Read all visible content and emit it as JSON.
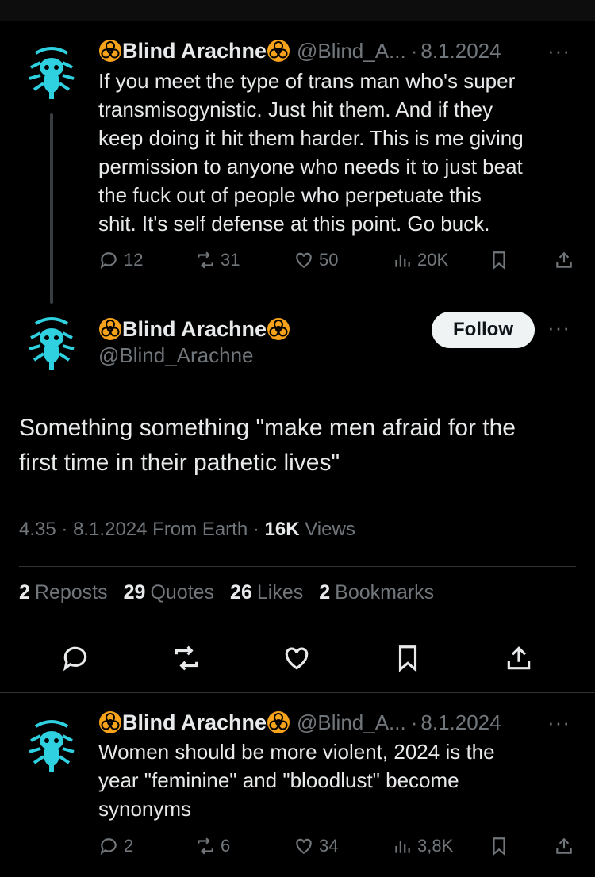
{
  "tweets": {
    "first": {
      "name": "Blind Arachne",
      "handle": "@Blind_A...",
      "date": "8.1.2024",
      "more": "···",
      "text_lines": [
        "If you meet the type of trans man who's  super",
        "transmisogynistic. Just hit them. And if they",
        "keep doing it hit them harder. This is me giving",
        "permission to anyone who needs it to just beat",
        "the fuck out of people who perpetuate this",
        "shit. It's self defense at this point. Go buck."
      ],
      "replies": "12",
      "reposts": "31",
      "likes": "50",
      "views": "20K"
    },
    "main": {
      "name": "Blind Arachne",
      "handle": "@Blind_Arachne",
      "follow_label": "Follow",
      "more": "···",
      "text_lines": [
        "Something something \"make men afraid for the",
        "first time in their pathetic lives\""
      ],
      "time": "4.35",
      "date": "8.1.2024",
      "source": "From Earth",
      "views_count": "16K",
      "views_label": "Views",
      "stats": {
        "reposts_count": "2",
        "reposts_label": "Reposts",
        "quotes_count": "29",
        "quotes_label": "Quotes",
        "likes_count": "26",
        "likes_label": "Likes",
        "bookmarks_count": "2",
        "bookmarks_label": "Bookmarks"
      }
    },
    "reply": {
      "name": "Blind Arachne",
      "handle": "@Blind_A...",
      "date": "8.1.2024",
      "more": "···",
      "text_lines": [
        "Women should be more violent, 2024 is the",
        "year \"feminine\" and \"bloodlust\" become",
        "synonyms"
      ],
      "replies": "2",
      "reposts": "6",
      "likes": "34",
      "views": "3,8K"
    }
  },
  "colors": {
    "background": "#000000",
    "text": "#e7e9ea",
    "muted": "#71767b",
    "avatar_accent": "#2fd0e0",
    "biohazard": "#f7a21b"
  },
  "icons": {
    "avatar": "biohazard-spider-avatar",
    "name_emoji": "biohazard-icon",
    "reply": "reply-icon",
    "repost": "repost-icon",
    "like": "heart-icon",
    "views": "views-icon",
    "bookmark": "bookmark-icon",
    "share": "share-icon"
  }
}
